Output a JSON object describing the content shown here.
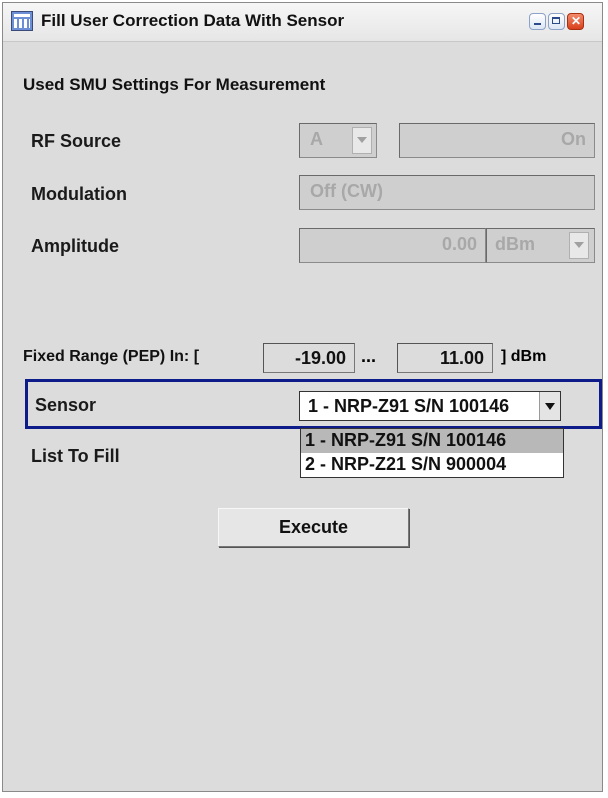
{
  "window": {
    "title": "Fill User Correction Data With Sensor"
  },
  "section_title": "Used SMU Settings For Measurement",
  "rf_source": {
    "label": "RF Source",
    "path_value": "A",
    "state_value": "On"
  },
  "modulation": {
    "label": "Modulation",
    "value": "Off (CW)"
  },
  "amplitude": {
    "label": "Amplitude",
    "value": "0.00",
    "unit": "dBm"
  },
  "fixed_range": {
    "label": "Fixed Range (PEP) In: [",
    "min": "-19.00",
    "separator": "...",
    "max": "11.00",
    "unit": "] dBm"
  },
  "sensor": {
    "label": "Sensor",
    "selected": "1 - NRP-Z91 S/N 100146",
    "options": [
      "1 - NRP-Z91 S/N 100146",
      "2 - NRP-Z21 S/N 900004"
    ]
  },
  "list_to_fill": {
    "label": "List To Fill"
  },
  "execute_label": "Execute"
}
